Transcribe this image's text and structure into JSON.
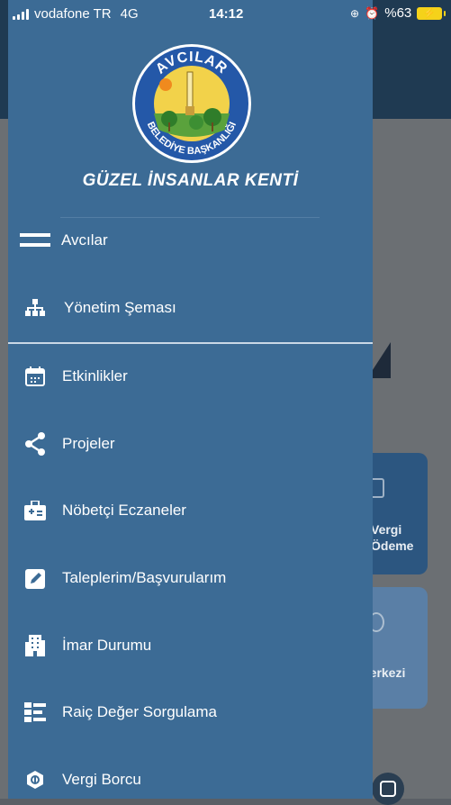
{
  "status_bar": {
    "carrier": "vodafone TR",
    "network": "4G",
    "time": "14:12",
    "battery": "%63"
  },
  "drawer": {
    "logo": {
      "top_text": "AVCILAR",
      "bottom_text": "BELEDİYE BAŞKANLIĞI"
    },
    "slogan": "GÜZEL İNSANLAR KENTİ",
    "items": [
      {
        "label": "Avcılar",
        "icon": "hamburger-menu-icon"
      },
      {
        "label": "Yönetim Şeması",
        "icon": "org-chart-icon"
      },
      {
        "label": "Etkinlikler",
        "icon": "calendar-icon"
      },
      {
        "label": "Projeler",
        "icon": "share-icon"
      },
      {
        "label": "Nöbetçi Eczaneler",
        "icon": "pharmacy-icon"
      },
      {
        "label": "Taleplerim/Başvurularım",
        "icon": "edit-request-icon"
      },
      {
        "label": "İmar Durumu",
        "icon": "building-icon"
      },
      {
        "label": "Raiç Değer Sorgulama",
        "icon": "list-query-icon"
      },
      {
        "label": "Vergi Borcu",
        "icon": "tax-icon"
      }
    ]
  },
  "background": {
    "card_1": [
      "Vergi",
      "Ödeme"
    ],
    "card_2": [
      "Merkezi"
    ]
  },
  "colors": {
    "drawer_bg": "#3c6b95",
    "top_bar": "#1f3a52",
    "battery": "#f5d21a"
  }
}
